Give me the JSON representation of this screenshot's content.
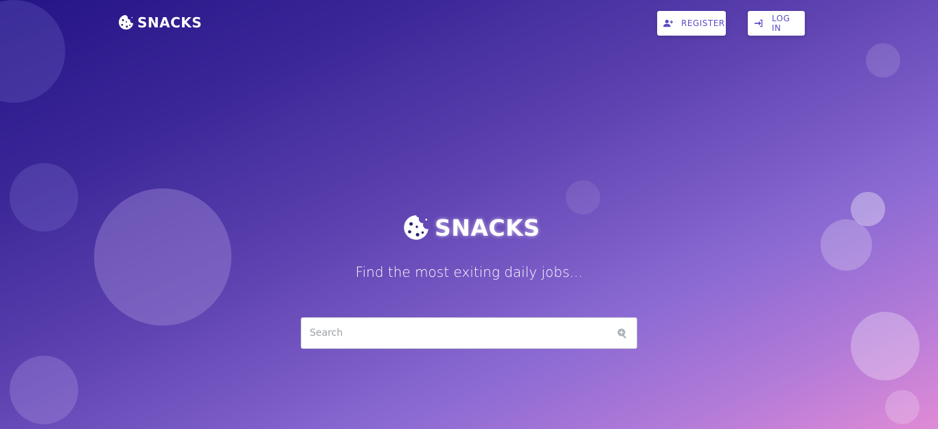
{
  "header": {
    "brand": "SNACKS",
    "register_label": "REGISTER",
    "login_label": "LOG IN"
  },
  "hero": {
    "brand": "SNACKS",
    "tagline": "Find the most exiting daily jobs...",
    "search_placeholder": "Search"
  },
  "icons": {
    "logo": "cookie-icon",
    "register": "user-plus-icon",
    "login": "sign-in-icon",
    "search": "search-plus-icon"
  },
  "colors": {
    "accent": "#5a4dc4",
    "gradient_start": "#241486",
    "gradient_end": "#e08bd6"
  }
}
